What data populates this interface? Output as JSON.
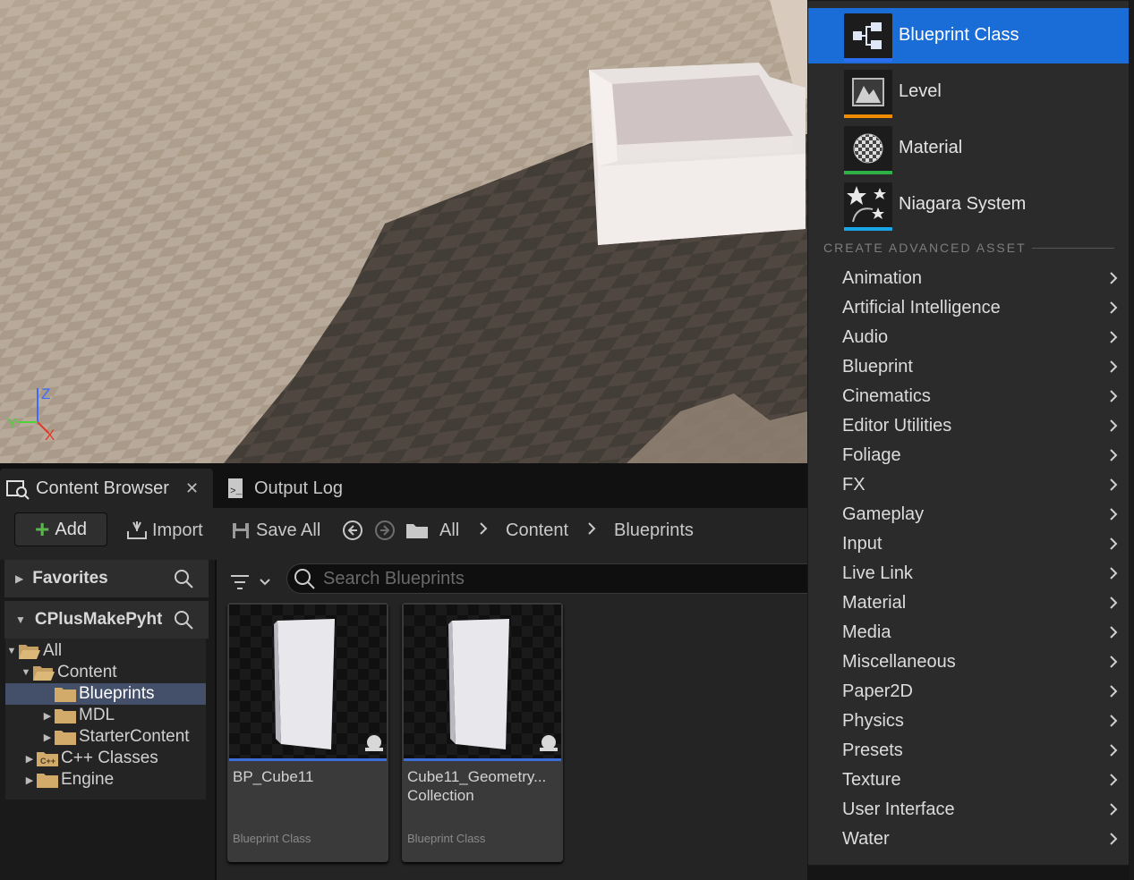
{
  "viewport": {
    "axis_labels": {
      "z": "Z",
      "y": "Y",
      "x": "X"
    }
  },
  "content_browser": {
    "tabs": [
      {
        "label": "Content Browser",
        "icon": "content-browser-icon",
        "active": true
      },
      {
        "label": "Output Log",
        "icon": "output-log-icon",
        "active": false
      }
    ],
    "toolbar": {
      "add_label": "Add",
      "import_label": "Import",
      "save_all_label": "Save All"
    },
    "breadcrumb": [
      "All",
      "Content",
      "Blueprints"
    ],
    "sources": {
      "favorites_label": "Favorites",
      "project_label": "CPlusMakePyht",
      "tree": [
        {
          "label": "All",
          "depth": 0,
          "expanded": true
        },
        {
          "label": "Content",
          "depth": 1,
          "expanded": true
        },
        {
          "label": "Blueprints",
          "depth": 2,
          "selected": true
        },
        {
          "label": "MDL",
          "depth": 2,
          "expanded": false
        },
        {
          "label": "StarterContent",
          "depth": 2,
          "expanded": false
        },
        {
          "label": "C++ Classes",
          "depth": 1,
          "expanded": false
        },
        {
          "label": "Engine",
          "depth": 1,
          "expanded": false
        }
      ]
    },
    "search": {
      "placeholder": "Search Blueprints",
      "value": ""
    },
    "assets": [
      {
        "name": "BP_Cube11",
        "type": "Blueprint Class"
      },
      {
        "name": "Cube11_Geometry... Collection",
        "name_line1": "Cube11_Geometry...",
        "name_line2": "Collection",
        "type": "Blueprint Class"
      }
    ]
  },
  "menu": {
    "basic_items": [
      {
        "label": "Blueprint Class",
        "icon": "blueprint-class-icon",
        "color": "#2a6df0",
        "highlighted": true
      },
      {
        "label": "Level",
        "icon": "level-icon",
        "color": "#f08c00"
      },
      {
        "label": "Material",
        "icon": "material-icon",
        "color": "#2fb14a"
      },
      {
        "label": "Niagara System",
        "icon": "niagara-system-icon",
        "color": "#18a6e6"
      }
    ],
    "advanced_title": "CREATE ADVANCED ASSET",
    "advanced_items": [
      "Animation",
      "Artificial Intelligence",
      "Audio",
      "Blueprint",
      "Cinematics",
      "Editor Utilities",
      "Foliage",
      "FX",
      "Gameplay",
      "Input",
      "Live Link",
      "Material",
      "Media",
      "Miscellaneous",
      "Paper2D",
      "Physics",
      "Presets",
      "Texture",
      "User Interface",
      "Water"
    ]
  },
  "colors": {
    "accent": "#1a6cd6",
    "add_plus": "#5bb450",
    "asset_bar": "#3d6dd9"
  }
}
